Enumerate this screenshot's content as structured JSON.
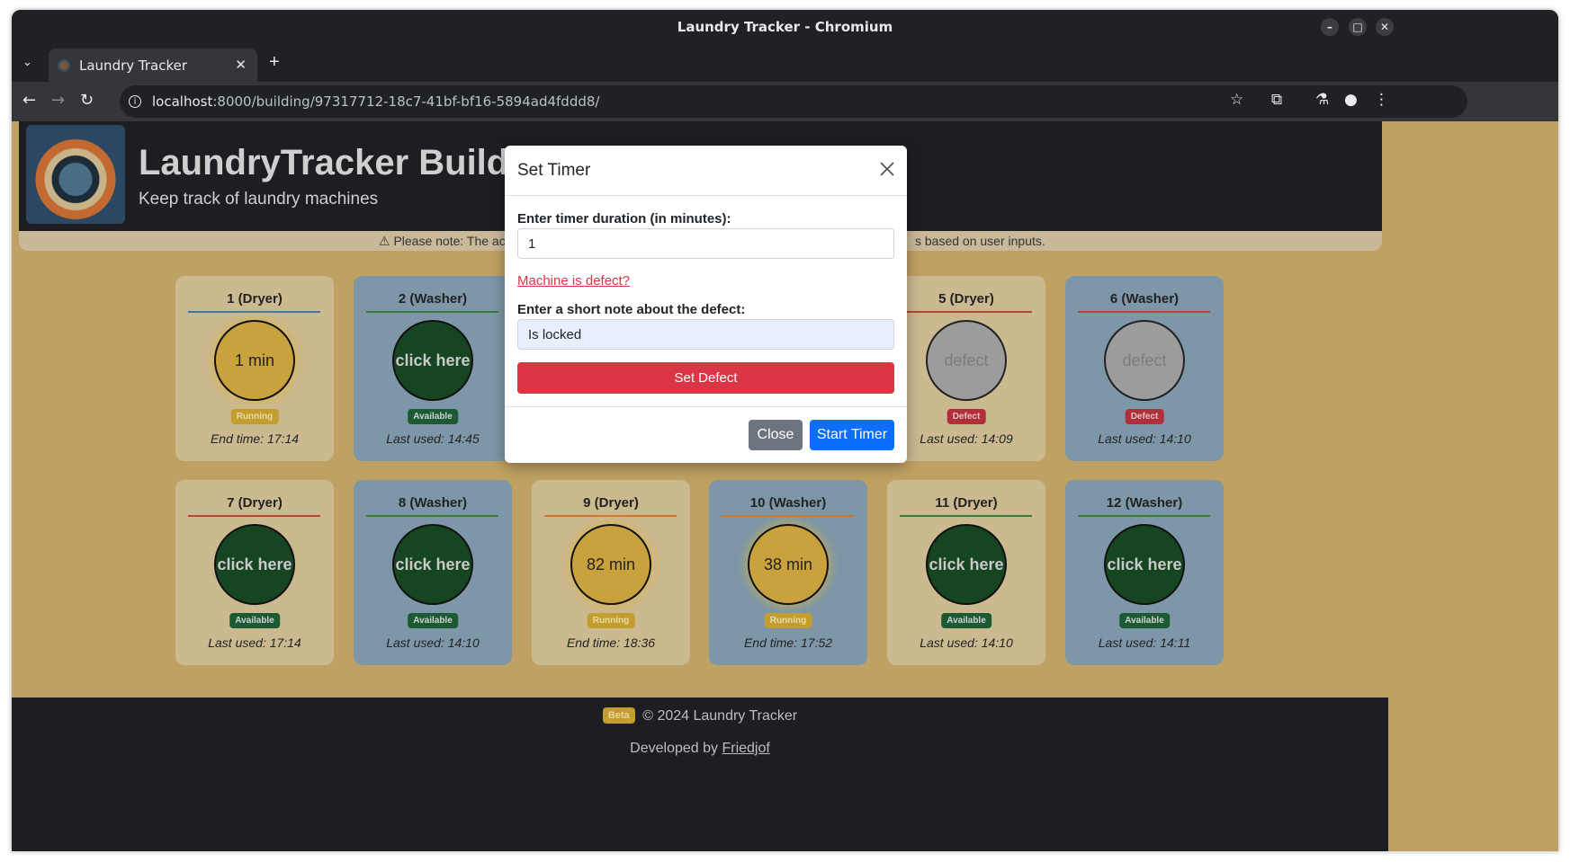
{
  "window": {
    "title": "Laundry Tracker - Chromium"
  },
  "tab": {
    "label": "Laundry Tracker"
  },
  "address": {
    "host": "localhost",
    "path": ":8000/building/97317712-18c7-41bf-bf16-5894ad4fddd8/"
  },
  "header": {
    "title": "LaundryTracker Building",
    "subtitle": "Keep track of laundry machines"
  },
  "notice": {
    "left": "⚠ Please note: The actu",
    "right": "s based on user inputs."
  },
  "machines": [
    {
      "title": "1 (Dryer)",
      "circle": "1 min",
      "status": "Running",
      "footer": "End time: 17:14"
    },
    {
      "title": "2 (Washer)",
      "circle": "click here",
      "status": "Available",
      "footer": "Last used: 14:45"
    },
    {
      "title": "5 (Dryer)",
      "circle": "defect",
      "status": "Defect",
      "footer": "Last used: 14:09"
    },
    {
      "title": "6 (Washer)",
      "circle": "defect",
      "status": "Defect",
      "footer": "Last used: 14:10"
    },
    {
      "title": "7 (Dryer)",
      "circle": "click here",
      "status": "Available",
      "footer": "Last used: 17:14"
    },
    {
      "title": "8 (Washer)",
      "circle": "click here",
      "status": "Available",
      "footer": "Last used: 14:10"
    },
    {
      "title": "9 (Dryer)",
      "circle": "82 min",
      "status": "Running",
      "footer": "End time: 18:36"
    },
    {
      "title": "10 (Washer)",
      "circle": "38 min",
      "status": "Running",
      "footer": "End time: 17:52"
    },
    {
      "title": "11 (Dryer)",
      "circle": "click here",
      "status": "Available",
      "footer": "Last used: 14:10"
    },
    {
      "title": "12 (Washer)",
      "circle": "click here",
      "status": "Available",
      "footer": "Last used: 14:11"
    }
  ],
  "modal": {
    "title": "Set Timer",
    "duration_label": "Enter timer duration (in minutes):",
    "duration_value": "1",
    "defect_link": "Machine is defect?",
    "note_label": "Enter a short note about the defect:",
    "note_value": "Is locked",
    "set_defect": "Set Defect",
    "close": "Close",
    "start": "Start Timer"
  },
  "footer": {
    "beta": "Beta",
    "copyright": "© 2024 Laundry Tracker",
    "developed_by": "Developed by ",
    "author": "Friedjof"
  },
  "colors": {
    "running": "#c9a23d",
    "available": "#164521",
    "defect": "#9c9c9c",
    "danger": "#dc3545",
    "primary": "#0d6efd",
    "secondary": "#6c757d"
  }
}
